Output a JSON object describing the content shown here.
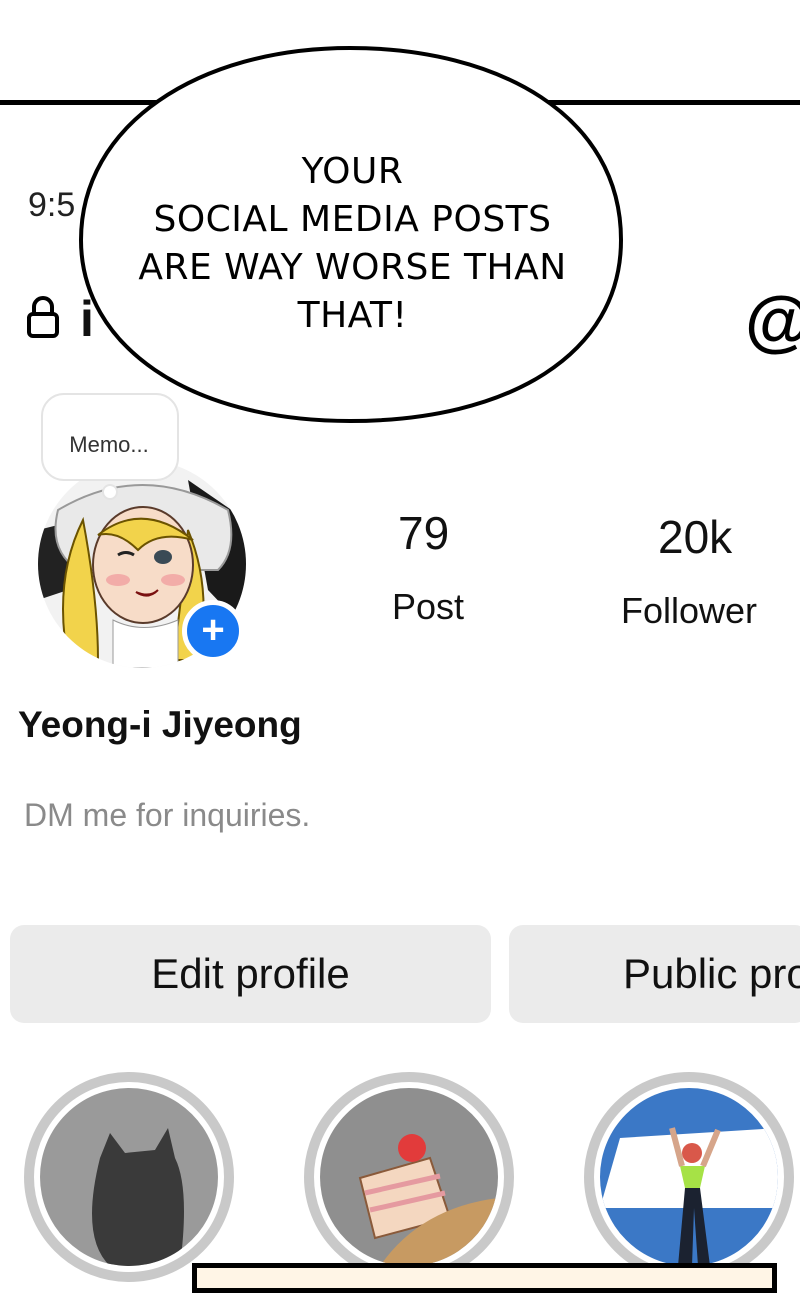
{
  "status_bar": {
    "time": "9:5"
  },
  "header": {
    "username_partial": "i"
  },
  "speech_bubble": {
    "lines": [
      "YOUR",
      "SOCIAL MEDIA POSTS",
      "ARE WAY WORSE THAN",
      "THAT!"
    ]
  },
  "memo": {
    "text": "Memo..."
  },
  "stats": {
    "posts": {
      "count": "79",
      "label": "Post"
    },
    "followers": {
      "count": "20k",
      "label": "Follower"
    }
  },
  "profile": {
    "name": "Yeong-i Jiyeong",
    "bio": "DM me for inquiries."
  },
  "buttons": {
    "edit_profile": "Edit profile",
    "public_profile": "Public pro"
  },
  "add_story": {
    "symbol": "+"
  },
  "colors": {
    "accent": "#1877f2",
    "button_bg": "#ebebeb",
    "bio_text": "#8a8a8a"
  },
  "icons": [
    "lock-icon",
    "at-sign-icon",
    "plus-icon"
  ]
}
